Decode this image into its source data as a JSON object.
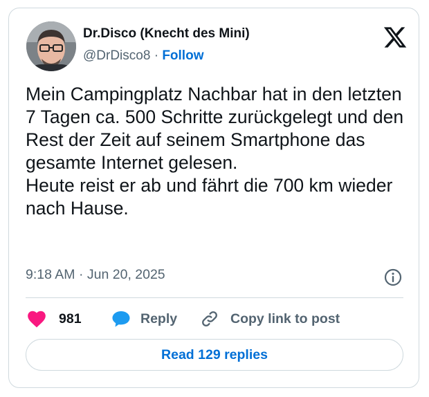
{
  "author": {
    "display_name": "Dr.Disco (Knecht des Mini)",
    "handle": "@DrDisco8",
    "separator": "·",
    "follow_label": "Follow"
  },
  "platform_logo": "x-logo-icon",
  "tweet": {
    "text": "Mein Campingplatz Nachbar hat in den letzten 7 Tagen ca. 500 Schritte zurückgelegt und den Rest der Zeit auf seinem Smartphone das gesamte Internet gelesen.\nHeute reist er ab und fährt die 700 km wieder nach Hause.",
    "time": "9:18 AM",
    "date_separator": "·",
    "date": "Jun 20, 2025"
  },
  "actions": {
    "like_count": "981",
    "reply_label": "Reply",
    "copy_link_label": "Copy link to post",
    "read_replies_label": "Read 129 replies"
  },
  "icons": {
    "like": "heart-icon",
    "reply": "speech-bubble-icon",
    "copy_link": "link-icon",
    "info": "info-icon"
  },
  "colors": {
    "accent": "#006fd6",
    "like": "#f91880",
    "reply": "#1d9bf0",
    "secondary_text": "#536471",
    "border": "#cfd9de"
  }
}
